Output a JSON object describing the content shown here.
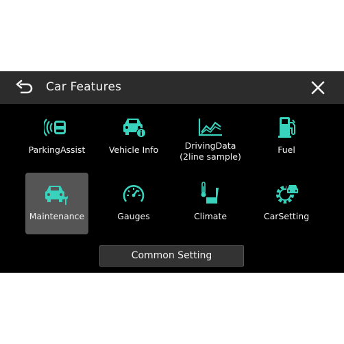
{
  "header": {
    "title": "Car Features",
    "back_icon": "back-arrow-icon",
    "close_icon": "close-icon"
  },
  "colors": {
    "accent": "#39d3bd",
    "header_bg": "#2c2c2c",
    "screen_bg": "#000000",
    "selected_bg": "#555555"
  },
  "features": [
    {
      "label": "ParkingAssist",
      "icon": "parking-assist-icon"
    },
    {
      "label": "Vehicle Info",
      "icon": "vehicle-info-icon"
    },
    {
      "label_line1": "DrivingData",
      "label_line2": "(2line sample)",
      "icon": "driving-data-icon"
    },
    {
      "label": "Fuel",
      "icon": "fuel-pump-icon"
    },
    {
      "label": "Maintenance",
      "icon": "maintenance-icon",
      "selected": true
    },
    {
      "label": "Gauges",
      "icon": "gauge-icon"
    },
    {
      "label": "Climate",
      "icon": "climate-icon"
    },
    {
      "label": "CarSetting",
      "icon": "car-setting-icon"
    }
  ],
  "footer": {
    "common_setting_label": "Common Setting"
  }
}
